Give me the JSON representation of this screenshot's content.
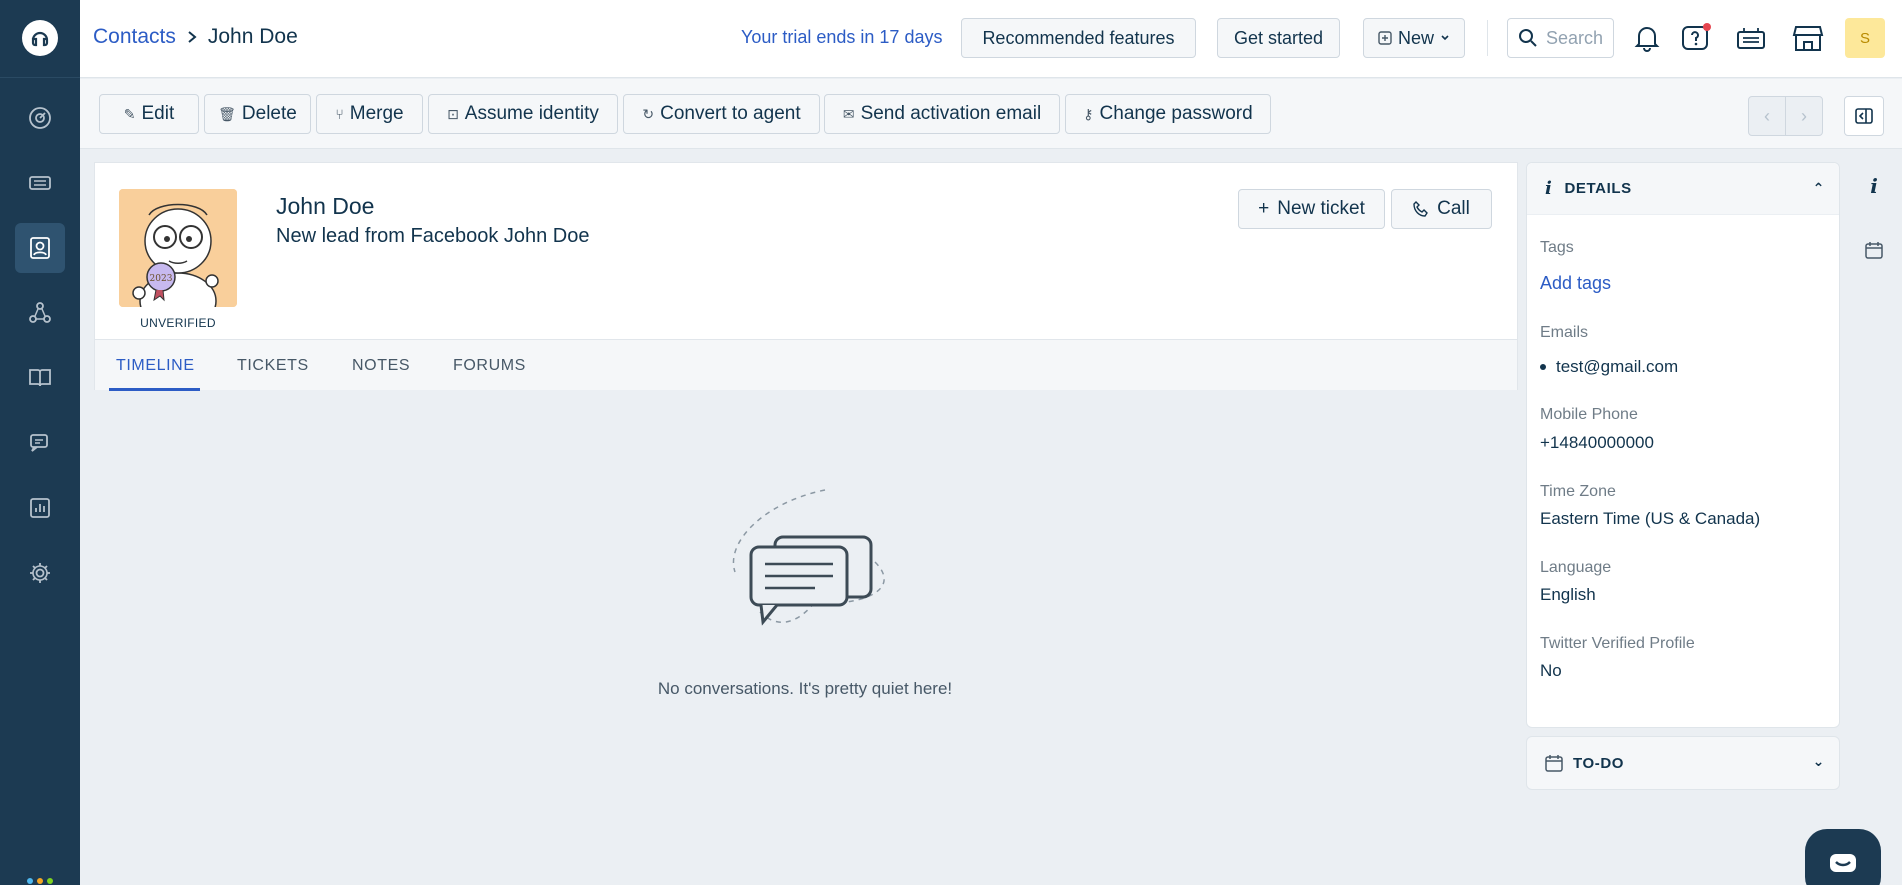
{
  "breadcrumb": {
    "root": "Contacts",
    "current": "John Doe"
  },
  "header": {
    "trial_text": "Your trial ends in 17 days",
    "recommended_label": "Recommended features",
    "get_started_label": "Get started",
    "new_label": "New",
    "search_placeholder": "Search",
    "avatar_initial": "S"
  },
  "toolbar": {
    "edit": "Edit",
    "delete": "Delete",
    "merge": "Merge",
    "assume_identity": "Assume identity",
    "convert": "Convert to agent",
    "send_activation": "Send activation email",
    "change_password": "Change password"
  },
  "contact": {
    "name": "John Doe",
    "description": "New lead from Facebook John Doe",
    "status": "UNVERIFIED",
    "new_ticket_label": "New ticket",
    "call_label": "Call"
  },
  "tabs": [
    "TIMELINE",
    "TICKETS",
    "NOTES",
    "FORUMS"
  ],
  "empty_state": "No conversations. It's pretty quiet here!",
  "details": {
    "title": "DETAILS",
    "tags_label": "Tags",
    "add_tags": "Add tags",
    "emails_label": "Emails",
    "email": "test@gmail.com",
    "mobile_label": "Mobile Phone",
    "mobile": "+14840000000",
    "timezone_label": "Time Zone",
    "timezone": "Eastern Time (US & Canada)",
    "language_label": "Language",
    "language": "English",
    "twitter_label": "Twitter Verified Profile",
    "twitter": "No"
  },
  "todo": {
    "title": "TO-DO"
  },
  "colors": {
    "accent": "#2c5cc5",
    "nav_bg": "#1c3a52",
    "text": "#12344d"
  }
}
